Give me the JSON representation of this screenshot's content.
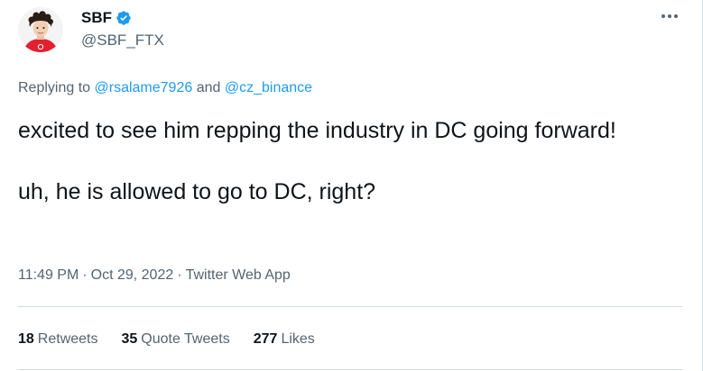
{
  "author": {
    "name": "SBF",
    "handle": "@SBF_FTX",
    "verified": true,
    "verified_color": "#1d9bf0"
  },
  "reply": {
    "prefix": "Replying to",
    "mentions": [
      "@rsalame7926",
      "@cz_binance"
    ],
    "conjunction": "and"
  },
  "tweet": {
    "paragraphs": [
      "excited to see him repping the industry in DC going forward!",
      "uh, he is allowed to go to DC, right?"
    ]
  },
  "meta": {
    "time": "11:49 PM",
    "date": "Oct 29, 2022",
    "source": "Twitter Web App",
    "separator": "·"
  },
  "stats": [
    {
      "count": "18",
      "label": "Retweets"
    },
    {
      "count": "35",
      "label": "Quote Tweets"
    },
    {
      "count": "277",
      "label": "Likes"
    }
  ],
  "icons": {
    "more": "more-horizontal-icon",
    "verified": "verified-badge-icon"
  },
  "colors": {
    "text": "#0f1419",
    "secondary": "#536471",
    "link": "#1d9bf0",
    "divider": "#cfd9de",
    "avatar_shirt": "#e2202f"
  }
}
